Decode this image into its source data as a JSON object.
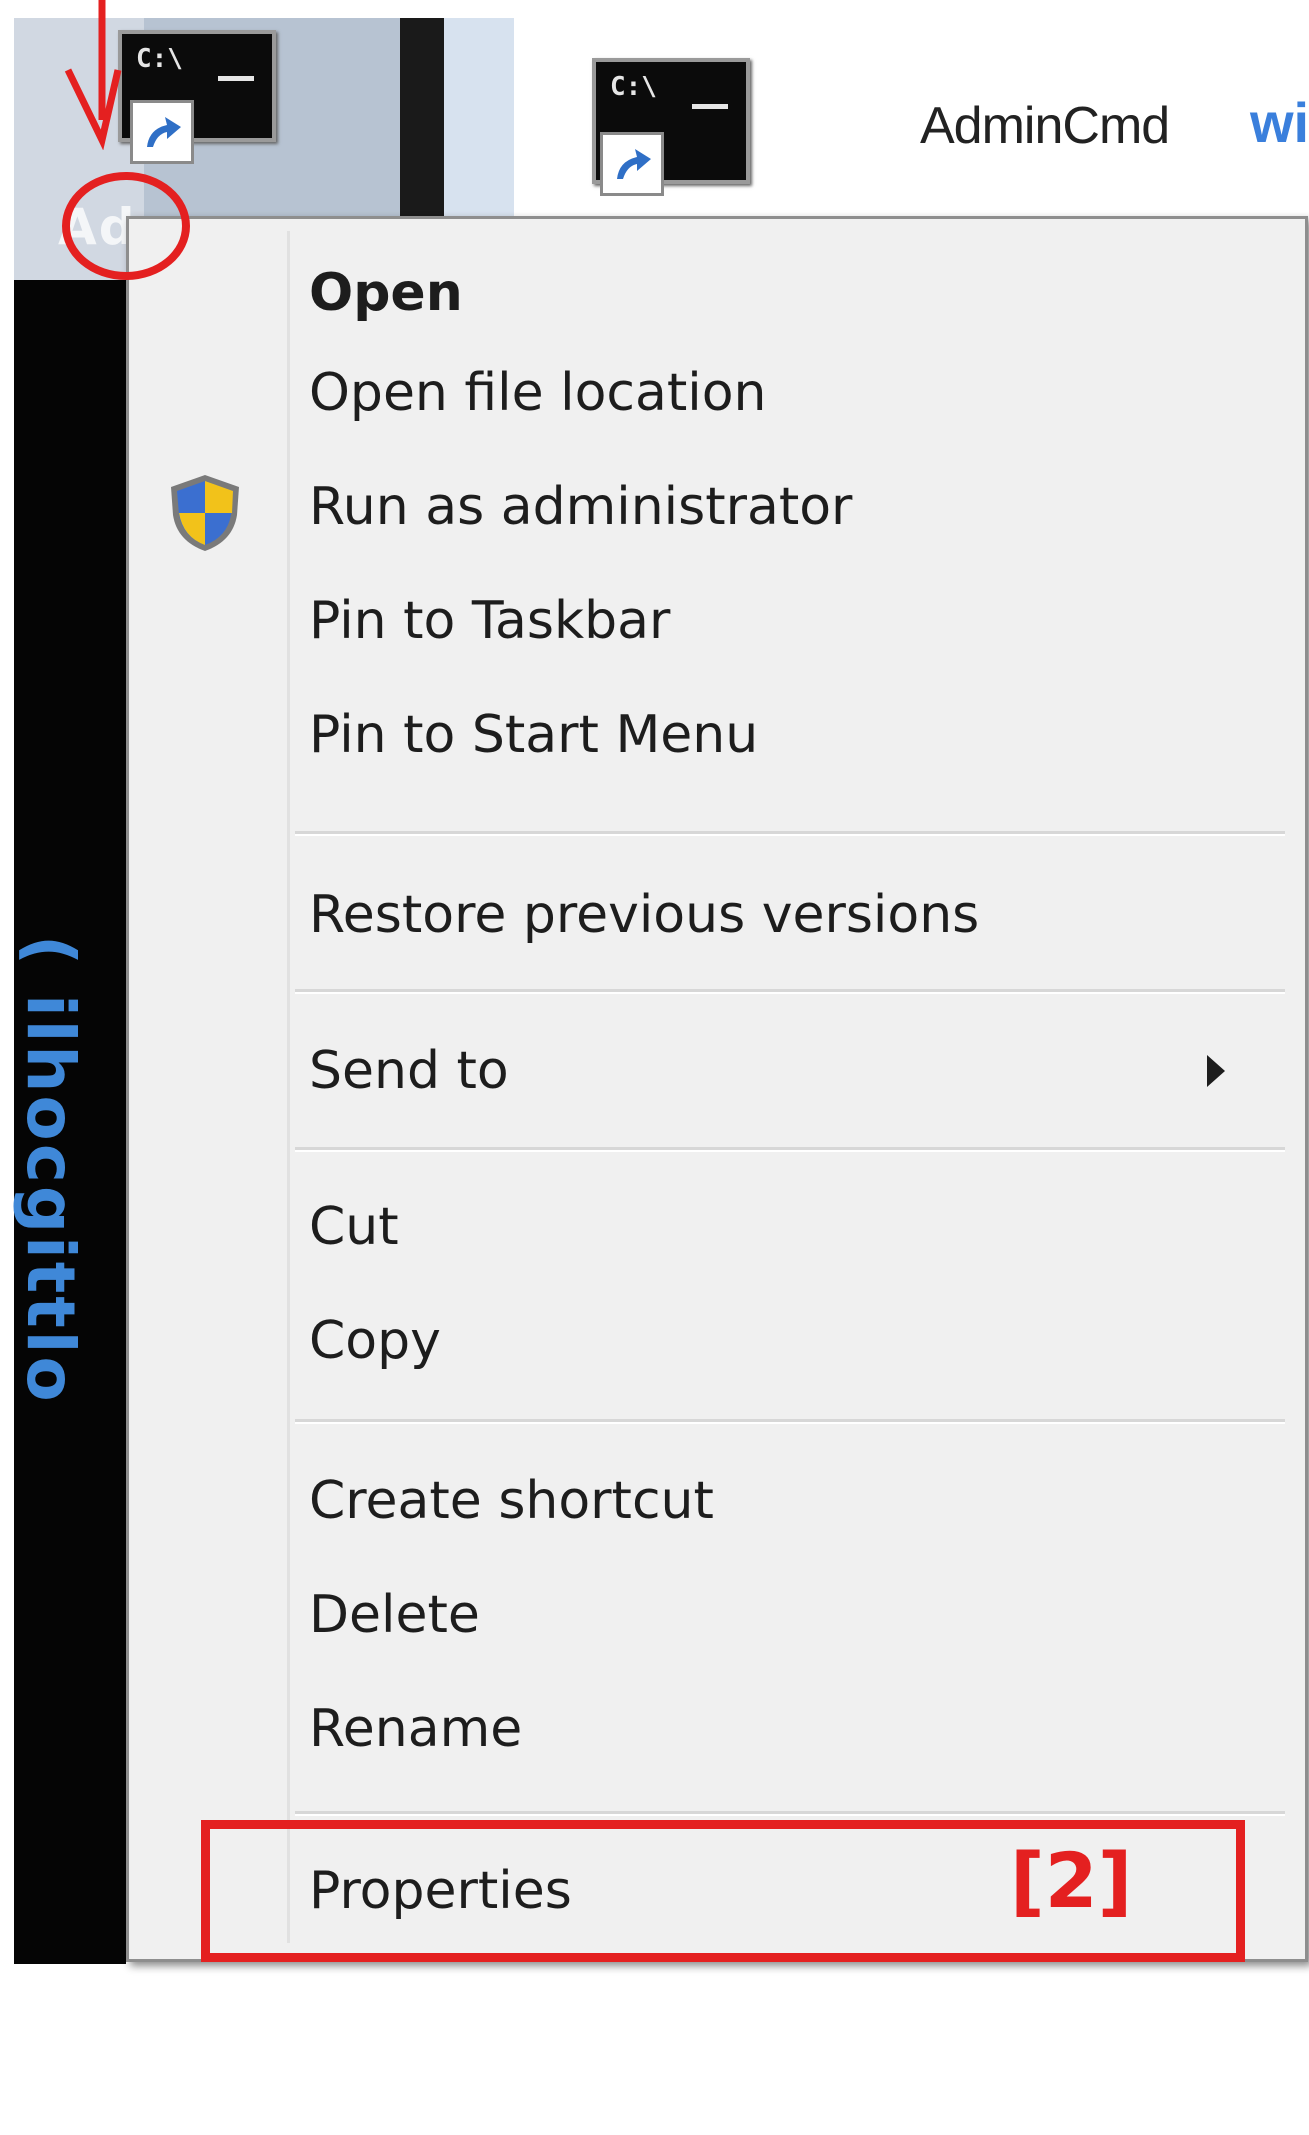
{
  "desktop": {
    "left_label_partial": "Ad",
    "left_vertical_text": "(  ilhocgittlo",
    "admin_label": "AdminCmd",
    "right_partial_label": "wi",
    "cmd_prompt": "C:\\"
  },
  "context_menu": {
    "items": [
      {
        "label": "Open"
      },
      {
        "label": "Open file location"
      },
      {
        "label": "Run as administrator"
      },
      {
        "label": "Pin to Taskbar"
      },
      {
        "label": "Pin to Start Menu"
      },
      {
        "label": "Restore previous versions"
      },
      {
        "label": "Send to"
      },
      {
        "label": "Cut"
      },
      {
        "label": "Copy"
      },
      {
        "label": "Create shortcut"
      },
      {
        "label": "Delete"
      },
      {
        "label": "Rename"
      },
      {
        "label": "Properties"
      }
    ]
  },
  "annotation": {
    "step_label": "[2]",
    "color": "#e42020"
  },
  "icons": {
    "shield": "uac-shield-icon",
    "submenu": "chevron-right-icon",
    "shortcut": "shortcut-arrow-icon",
    "cmd": "command-prompt-icon"
  }
}
